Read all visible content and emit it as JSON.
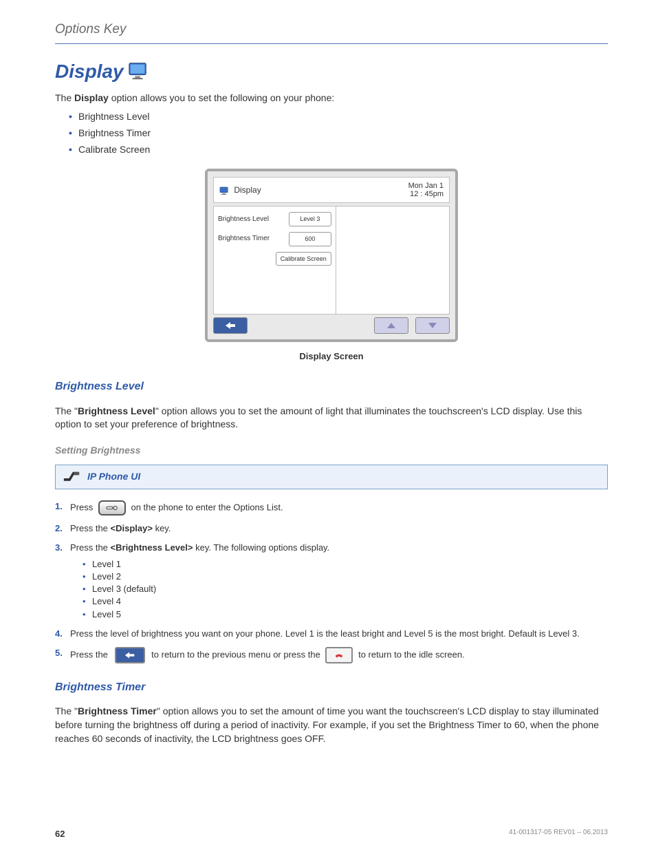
{
  "header": {
    "breadcrumb": "Options Key"
  },
  "heading": "Display",
  "intro_pre": "The ",
  "intro_bold": "Display",
  "intro_post": " option allows you to set the following on your phone:",
  "top_list": [
    "Brightness Level",
    "Brightness Timer",
    "Calibrate Screen"
  ],
  "phone_screen": {
    "title": "Display",
    "date": "Mon Jan 1",
    "time": "12 : 45pm",
    "rows": {
      "brightness_level_label": "Brightness Level",
      "brightness_level_value": "Level 3",
      "brightness_timer_label": "Brightness Timer",
      "brightness_timer_value": "600",
      "calibrate_btn": "Calibrate Screen"
    }
  },
  "figure_caption": "Display Screen",
  "section_bl": {
    "heading": "Brightness Level",
    "para_pre": "The \"",
    "para_bold": "Brightness Level",
    "para_post": "\" option allows you to set the amount of light that illuminates the touchscreen's LCD display. Use this option to set your preference of brightness."
  },
  "setting_brightness": "Setting Brightness",
  "ip_phone_ui": "IP Phone UI",
  "steps": {
    "s1_pre": "Press ",
    "s1_post": " on the phone to enter the Options List.",
    "s2_pre": "Press the ",
    "s2_bold": "<Display>",
    "s2_post": " key.",
    "s3_pre": "Press the ",
    "s3_bold": "<Brightness Level>",
    "s3_post": " key. The following options display.",
    "levels": [
      "Level 1",
      "Level 2",
      "Level 3 (default)",
      "Level 4",
      "Level 5"
    ],
    "s4": "Press the level of brightness you want on your phone. Level 1 is the least bright and Level 5 is the most bright. Default is Level 3.",
    "s5_pre": "Press the ",
    "s5_mid": " to return to the previous menu or press the ",
    "s5_post": " to return to the idle screen."
  },
  "section_bt": {
    "heading": "Brightness Timer",
    "para_pre": "The \"",
    "para_bold": "Brightness Timer",
    "para_post": "\" option allows you to set the amount of time you want the touchscreen's LCD display to stay illuminated before turning the brightness off during a period of inactivity. For example, if you set the Brightness Timer to 60, when the phone reaches 60 seconds of inactivity, the LCD brightness goes OFF."
  },
  "footer": {
    "page": "62",
    "docid": "41-001317-05 REV01 – 06.2013"
  }
}
